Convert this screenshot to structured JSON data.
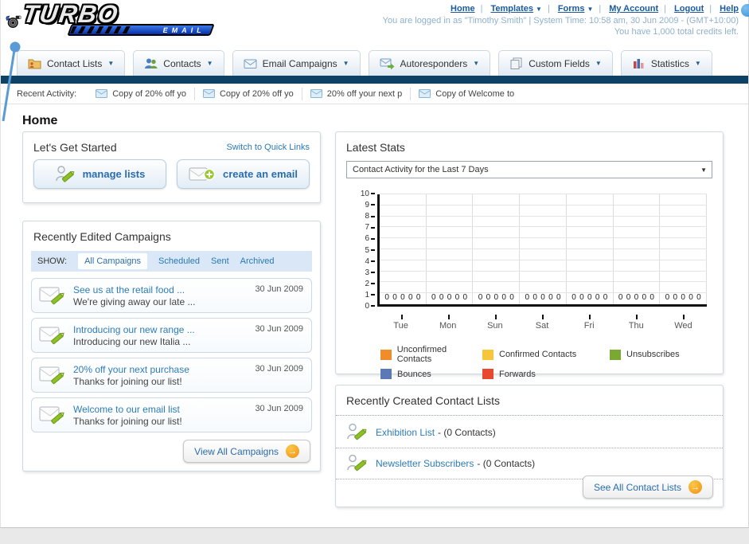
{
  "header": {
    "logo": {
      "title": "TURBO",
      "subtitle": "EMAIL"
    },
    "nav_links": [
      {
        "label": "Home",
        "has_dropdown": false
      },
      {
        "label": "Templates",
        "has_dropdown": true
      },
      {
        "label": "Forms",
        "has_dropdown": true
      },
      {
        "label": "My Account",
        "has_dropdown": false
      },
      {
        "label": "Logout",
        "has_dropdown": false
      },
      {
        "label": "Help",
        "has_dropdown": false
      }
    ],
    "login_status": "You are logged in as \"Timothy Smith\" | System Time: 10:58 am, 30 Jun 2009 - (GMT+10:00)",
    "credits": "You have 1,000 total credits left."
  },
  "nav_tabs": [
    {
      "label": "Contact Lists"
    },
    {
      "label": "Contacts"
    },
    {
      "label": "Email Campaigns"
    },
    {
      "label": "Autoresponders"
    },
    {
      "label": "Custom Fields"
    },
    {
      "label": "Statistics"
    }
  ],
  "recent_activity": {
    "label": "Recent Activity:",
    "items": [
      {
        "text": "Copy of 20% off yo"
      },
      {
        "text": "Copy of 20% off yo"
      },
      {
        "text": "20% off your next p"
      },
      {
        "text": "Copy of Welcome to"
      }
    ]
  },
  "page_title": "Home",
  "get_started": {
    "title": "Let's Get Started",
    "switch_link": "Switch to Quick Links",
    "manage_lists_label": "manage lists",
    "create_email_label": "create an email"
  },
  "campaigns": {
    "title": "Recently Edited Campaigns",
    "show_label": "SHOW:",
    "filters": [
      {
        "label": "All Campaigns",
        "active": true
      },
      {
        "label": "Scheduled",
        "active": false
      },
      {
        "label": "Sent",
        "active": false
      },
      {
        "label": "Archived",
        "active": false
      }
    ],
    "items": [
      {
        "title": "See us at the retail food ...",
        "subtitle": "We're giving away our late ...",
        "date": "30 Jun 2009"
      },
      {
        "title": "Introducing our new range ...",
        "subtitle": "Introducing our new Italia ...",
        "date": "30 Jun 2009"
      },
      {
        "title": "20% off your next purchase",
        "subtitle": "Thanks for joining our list!",
        "date": "30 Jun 2009"
      },
      {
        "title": "Welcome to our email list",
        "subtitle": "Thanks for joining our list!",
        "date": "30 Jun 2009"
      }
    ],
    "view_all_label": "View All Campaigns"
  },
  "latest_stats": {
    "title": "Latest Stats",
    "selected_option": "Contact Activity for the Last 7 Days"
  },
  "chart_data": {
    "type": "bar",
    "categories": [
      "Tue",
      "Mon",
      "Sun",
      "Sat",
      "Fri",
      "Thu",
      "Wed"
    ],
    "series": [
      {
        "name": "Unconfirmed Contacts",
        "color": "#f08c2a",
        "values": [
          0,
          0,
          0,
          0,
          0,
          0,
          0
        ]
      },
      {
        "name": "Confirmed Contacts",
        "color": "#f5c53a",
        "values": [
          0,
          0,
          0,
          0,
          0,
          0,
          0
        ]
      },
      {
        "name": "Unsubscribes",
        "color": "#7aa832",
        "values": [
          0,
          0,
          0,
          0,
          0,
          0,
          0
        ]
      },
      {
        "name": "Bounces",
        "color": "#5b7ab5",
        "values": [
          0,
          0,
          0,
          0,
          0,
          0,
          0
        ]
      },
      {
        "name": "Forwards",
        "color": "#e8492e",
        "values": [
          0,
          0,
          0,
          0,
          0,
          0,
          0
        ]
      }
    ],
    "title": "Contact Activity for the Last 7 Days",
    "xlabel": "",
    "ylabel": "",
    "ylim": [
      0,
      10
    ],
    "yticks": [
      0,
      1,
      2,
      3,
      4,
      5,
      6,
      7,
      8,
      9,
      10
    ],
    "grid": true,
    "legend_position": "bottom"
  },
  "contact_lists": {
    "title": "Recently Created Contact Lists",
    "items": [
      {
        "name": "Exhibition List",
        "detail": "- (0 Contacts)"
      },
      {
        "name": "Newsletter Subscribers",
        "detail": "- (0 Contacts)"
      }
    ],
    "see_all_label": "See All Contact Lists"
  },
  "colors": {
    "navy_bar": "#0d4266",
    "link_blue": "#2a78b8",
    "accent_orange": "#ef9010",
    "logo_blue": "#1a4fd0"
  }
}
